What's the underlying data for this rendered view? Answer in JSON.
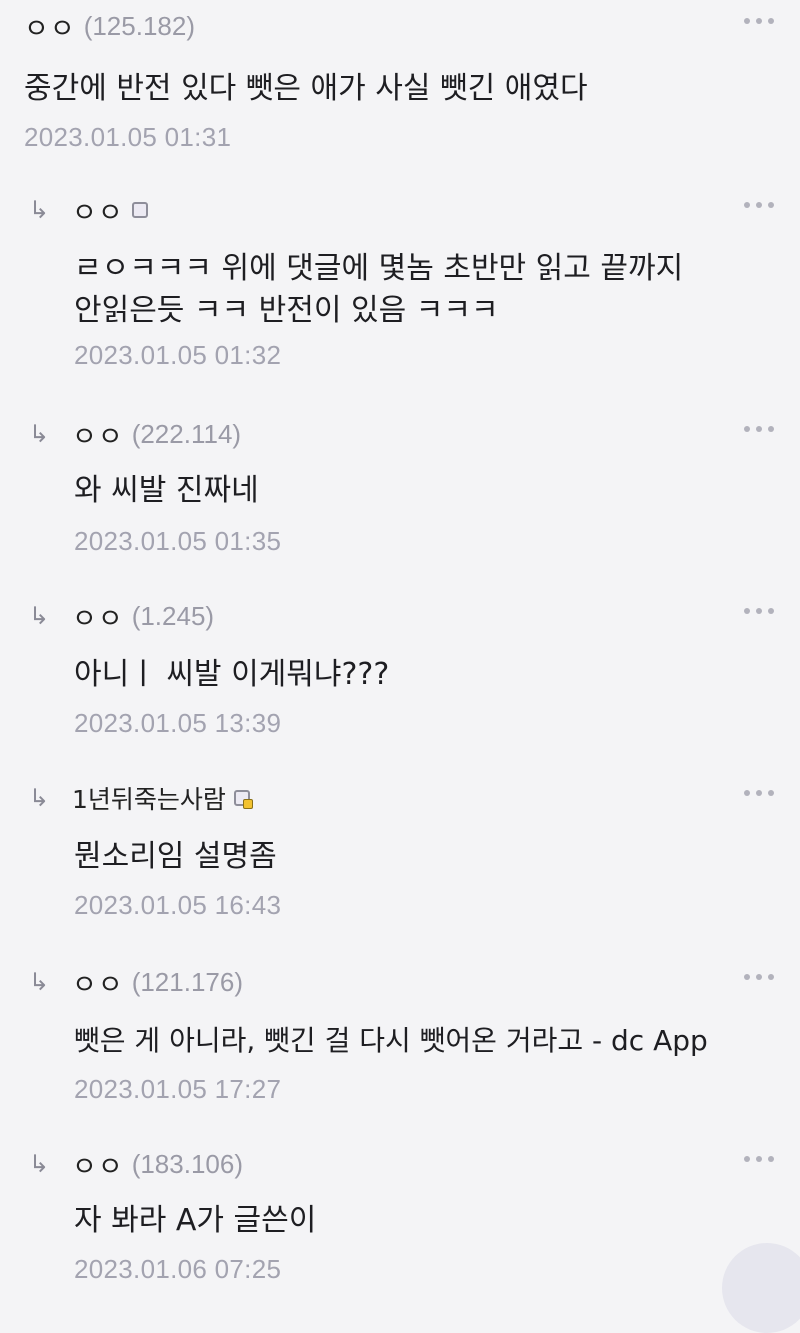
{
  "comments": [
    {
      "nick": "ㅇㅇ",
      "ip": "(125.182)",
      "body": "중간에 반전 있다 뺏은 애가 사실 뺏긴 애였다",
      "date": "2023.01.05 01:31"
    },
    {
      "nick": "ㅇㅇ",
      "ip": "",
      "body": "ㄹㅇㅋㅋㅋ 위에 댓글에 몇놈 초반만 읽고 끝까지\n안읽은듯 ㅋㅋ 반전이 있음 ㅋㅋㅋ",
      "date": "2023.01.05 01:32"
    },
    {
      "nick": "ㅇㅇ",
      "ip": "(222.114)",
      "body": "와 씨발 진짜네",
      "date": "2023.01.05 01:35"
    },
    {
      "nick": "ㅇㅇ",
      "ip": "(1.245)",
      "body": "아니ㅣ 씨발 이게뭐냐???",
      "date": "2023.01.05 13:39"
    },
    {
      "nick": "1년뒤죽는사람",
      "ip": "",
      "body": "뭔소리임 설명좀",
      "date": "2023.01.05 16:43"
    },
    {
      "nick": "ㅇㅇ",
      "ip": "(121.176)",
      "body": "뺏은 게 아니라, 뺏긴 걸 다시 뺏어온 거라고 - dc App",
      "date": "2023.01.05 17:27"
    },
    {
      "nick": "ㅇㅇ",
      "ip": "(183.106)",
      "body": "자 봐라 A가 글쓴이",
      "date": "2023.01.06 07:25"
    }
  ],
  "icons": {
    "reply": "reply-arrow-icon",
    "more": "more-dots-icon",
    "badge": "member-badge-icon"
  },
  "colors": {
    "background": "#f4f4f6",
    "muted": "#a3a3b0"
  }
}
